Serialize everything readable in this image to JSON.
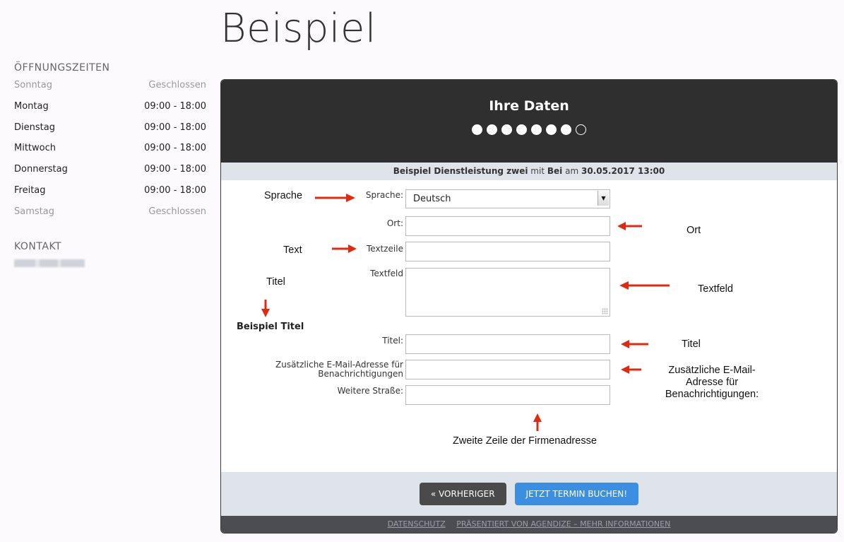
{
  "page": {
    "title": "Beispiel"
  },
  "sidebar": {
    "hours_title": "ÖFFNUNGSZEITEN",
    "hours": [
      {
        "day": "Sonntag",
        "time": "Geschlossen",
        "closed": true
      },
      {
        "day": "Montag",
        "time": "09:00 - 18:00",
        "closed": false
      },
      {
        "day": "Dienstag",
        "time": "09:00 - 18:00",
        "closed": false
      },
      {
        "day": "Mittwoch",
        "time": "09:00 - 18:00",
        "closed": false
      },
      {
        "day": "Donnerstag",
        "time": "09:00 - 18:00",
        "closed": false
      },
      {
        "day": "Freitag",
        "time": "09:00 - 18:00",
        "closed": false
      },
      {
        "day": "Samstag",
        "time": "Geschlossen",
        "closed": true
      }
    ],
    "contact_title": "KONTAKT"
  },
  "widget": {
    "title": "Ihre Daten",
    "steps_total": 8,
    "steps_completed": 7,
    "summary": {
      "service": "Beispiel Dienstleistung zwei",
      "with_word": "mit",
      "provider": "Bei",
      "at_word": "am",
      "datetime": "30.05.2017 13:00"
    },
    "form": {
      "language_label": "Sprache:",
      "language_value": "Deutsch",
      "city_label": "Ort:",
      "textline_label": "Textzeile",
      "textarea_label": "Textfeld",
      "section_heading": "Beispiel Titel",
      "title_label": "Titel:",
      "email_label_1": "Zusätzliche E-Mail-Adresse für",
      "email_label_2": "Benachrichtigungen",
      "street_label": "Weitere Straße:"
    },
    "buttons": {
      "prev": "« VORHERIGER",
      "book": "JETZT TERMIN BUCHEN!"
    },
    "footer": {
      "privacy": "DATENSCHUTZ",
      "powered": "PRÄSENTIERT VON AGENDIZE – MEHR INFORMATIONEN"
    }
  },
  "annotations": {
    "sprache": "Sprache",
    "text": "Text",
    "titel_left": "Titel",
    "ort": "Ort",
    "textfeld": "Textfeld",
    "titel_right": "Titel",
    "email_1": "Zusätzliche E-Mail-",
    "email_2": "Adresse für",
    "email_3": "Benachrichtigungen:",
    "street": "Zweite Zeile der Firmenadresse"
  },
  "colors": {
    "header_bg": "#2f2f2f",
    "accent_button": "#3c8ee0",
    "annotation_arrow": "#e02a10"
  }
}
